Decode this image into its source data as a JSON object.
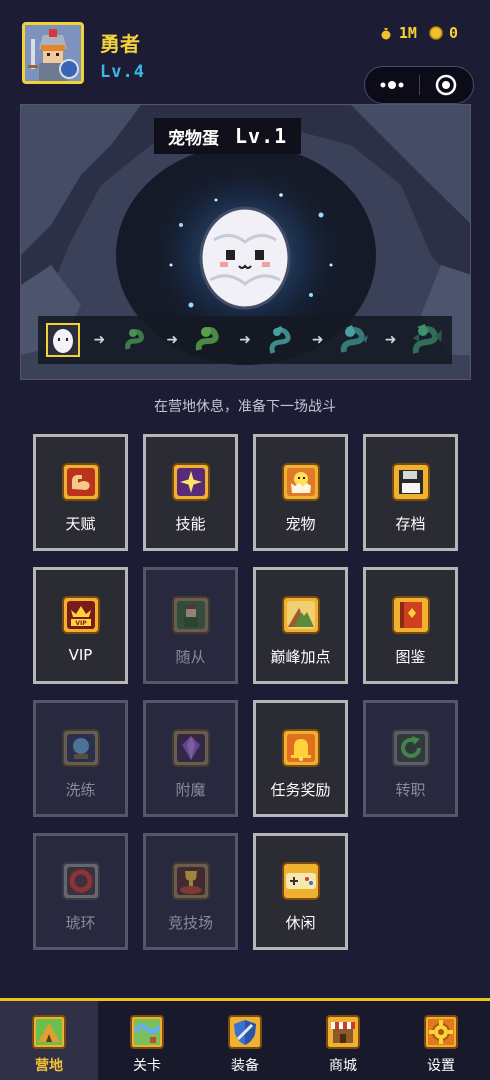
{
  "player": {
    "name": "勇者",
    "level": "Lv.4"
  },
  "currency": {
    "gold": "1M",
    "coins": "0"
  },
  "pet": {
    "title": "宠物蛋",
    "level": "Lv.1",
    "evolution_icons": [
      "egg-icon",
      "baby-snake-icon",
      "snake-icon",
      "serpent-icon",
      "small-dragon-icon",
      "dragon-icon"
    ]
  },
  "status_text": "在营地休息，准备下一场战斗",
  "menu": [
    {
      "label": "天赋",
      "icon": "muscle-arm-icon",
      "enabled": true
    },
    {
      "label": "技能",
      "icon": "sparkle-star-icon",
      "enabled": true
    },
    {
      "label": "宠物",
      "icon": "hatching-chick-icon",
      "enabled": true
    },
    {
      "label": "存档",
      "icon": "floppy-disk-icon",
      "enabled": true
    },
    {
      "label": "VIP",
      "icon": "vip-crown-icon",
      "enabled": true
    },
    {
      "label": "随从",
      "icon": "companion-icon",
      "enabled": false
    },
    {
      "label": "巅峰加点",
      "icon": "mountain-peak-icon",
      "enabled": true
    },
    {
      "label": "图鉴",
      "icon": "book-icon",
      "enabled": true
    },
    {
      "label": "洗练",
      "icon": "crystal-ball-icon",
      "enabled": false
    },
    {
      "label": "附魔",
      "icon": "purple-gem-icon",
      "enabled": false
    },
    {
      "label": "任务奖励",
      "icon": "bell-icon",
      "enabled": true
    },
    {
      "label": "转职",
      "icon": "rotate-arrow-icon",
      "enabled": false
    },
    {
      "label": "琥环",
      "icon": "red-ring-icon",
      "enabled": false
    },
    {
      "label": "竞技场",
      "icon": "trophy-arena-icon",
      "enabled": false
    },
    {
      "label": "休闲",
      "icon": "gamepad-icon",
      "enabled": true
    }
  ],
  "nav": [
    {
      "label": "营地",
      "icon": "camp-tent-icon",
      "active": true
    },
    {
      "label": "关卡",
      "icon": "map-icon",
      "active": false
    },
    {
      "label": "装备",
      "icon": "shield-icon",
      "active": false
    },
    {
      "label": "商城",
      "icon": "shop-icon",
      "active": false
    },
    {
      "label": "设置",
      "icon": "gear-icon",
      "active": false
    }
  ]
}
